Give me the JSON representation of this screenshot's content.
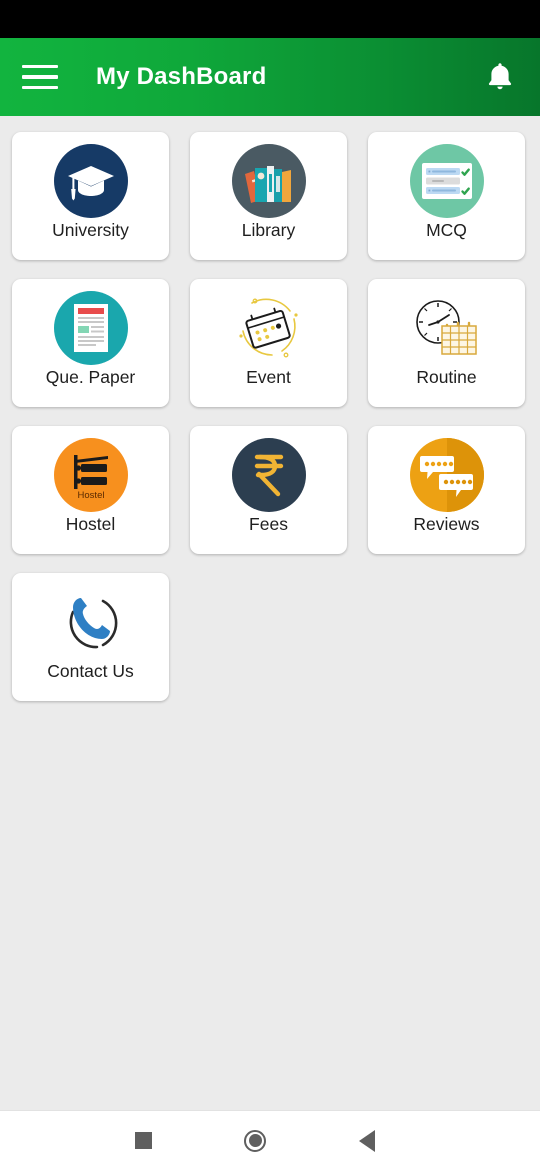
{
  "app": {
    "title": "My DashBoard",
    "menu_icon": "hamburger-menu-icon",
    "notification_icon": "bell-icon",
    "header_gradient_from": "#12b43f",
    "header_gradient_to": "#07762b",
    "background_color": "#ebebeb",
    "statusbar_color": "#000000"
  },
  "dashboard": {
    "tiles": [
      {
        "label": "University",
        "icon": "graduation-cap-icon",
        "circle_color": "#163a66"
      },
      {
        "label": "Library",
        "icon": "books-icon",
        "circle_color": "#4a5a63"
      },
      {
        "label": "MCQ",
        "icon": "checklist-card-icon",
        "circle_color": "#6ec7a5"
      },
      {
        "label": "Que. Paper",
        "icon": "document-icon",
        "circle_color": "#1aa7ad"
      },
      {
        "label": "Event",
        "icon": "calendar-event-icon",
        "circle_color": "#ffffff"
      },
      {
        "label": "Routine",
        "icon": "clock-calendar-icon",
        "circle_color": "#ffffff"
      },
      {
        "label": "Hostel",
        "icon": "bunk-bed-icon",
        "circle_color": "#f7901e"
      },
      {
        "label": "Fees",
        "icon": "rupee-icon",
        "circle_color": "#2c3e50"
      },
      {
        "label": "Reviews",
        "icon": "chat-stars-icon",
        "circle_color": "#eda113"
      },
      {
        "label": "Contact Us",
        "icon": "phone-icon",
        "circle_color": "#ffffff"
      }
    ]
  },
  "hostel_icon_text": "Hostel",
  "navbar": {
    "recents_label": "recents-square",
    "home_label": "home-circle",
    "back_label": "back-triangle",
    "icon_color": "#5f5f5f"
  }
}
